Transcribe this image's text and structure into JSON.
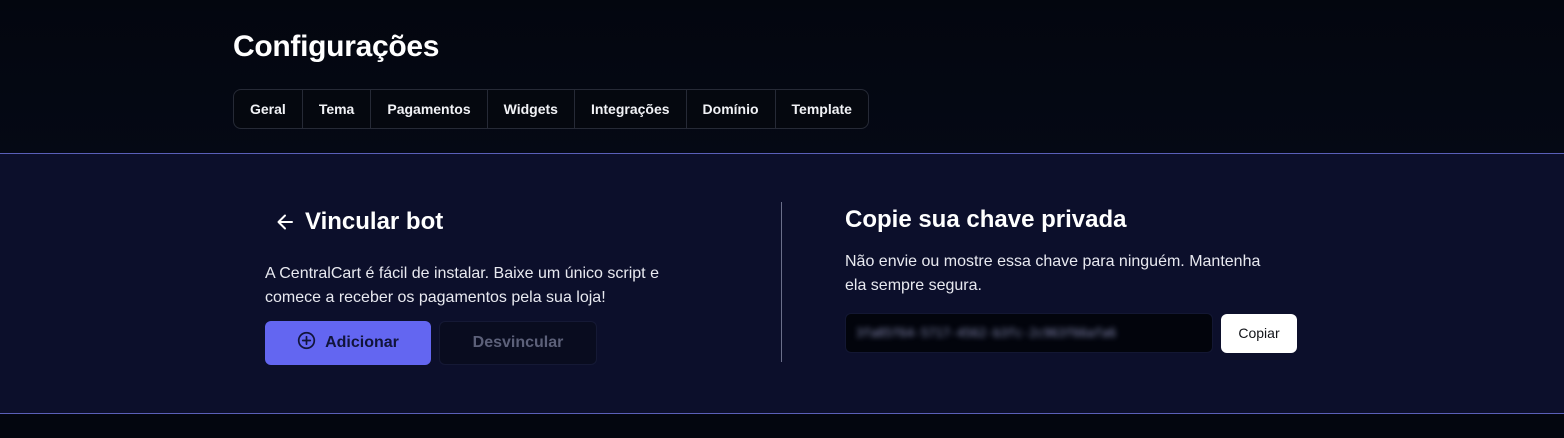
{
  "header": {
    "title": "Configurações",
    "tabs": [
      {
        "label": "Geral"
      },
      {
        "label": "Tema"
      },
      {
        "label": "Pagamentos"
      },
      {
        "label": "Widgets"
      },
      {
        "label": "Integrações"
      },
      {
        "label": "Domínio"
      },
      {
        "label": "Template"
      }
    ]
  },
  "bot_section": {
    "back_icon": "arrow-left-icon",
    "title": "Vincular bot",
    "description": "A CentralCart é fácil de instalar. Baixe um único script e comece a receber os pagamentos pela sua loja!",
    "add_icon": "plus-circle-icon",
    "add_label": "Adicionar",
    "unlink_label": "Desvincular"
  },
  "key_section": {
    "title": "Copie sua chave privada",
    "description": "Não envie ou mostre essa chave para ninguém. Mantenha ela sempre segura.",
    "key_value": "3fa85f64-5717-4562-b3fc-2c963f66afa6",
    "copy_label": "Copiar"
  },
  "colors": {
    "accent": "#6366f1",
    "panel_bg": "#0c0f2b",
    "page_bg": "#03060f"
  }
}
